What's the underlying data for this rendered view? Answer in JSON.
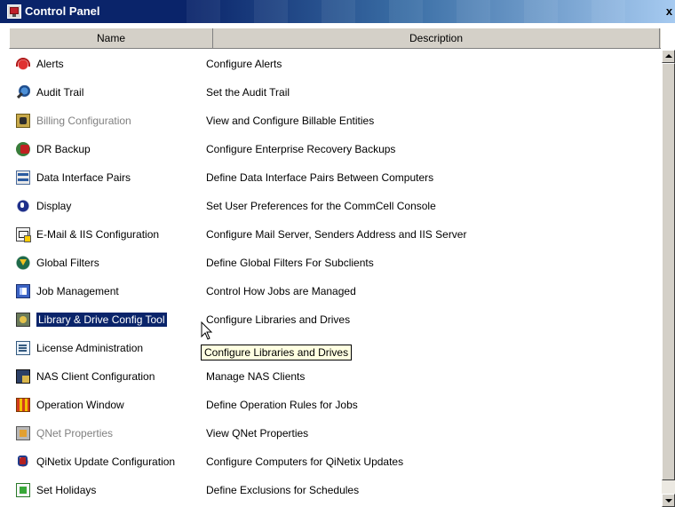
{
  "window": {
    "title": "Control Panel",
    "close_label": "x"
  },
  "table": {
    "headers": [
      "Name",
      "Description"
    ],
    "rows": [
      {
        "name": "Alerts",
        "description": "Configure Alerts",
        "icon": "alerts-icon",
        "state": "normal"
      },
      {
        "name": "Audit Trail",
        "description": "Set the Audit Trail",
        "icon": "audit-trail-icon",
        "state": "normal"
      },
      {
        "name": "Billing Configuration",
        "description": "View and Configure Billable Entities",
        "icon": "billing-icon",
        "state": "disabled"
      },
      {
        "name": "DR Backup",
        "description": "Configure Enterprise Recovery Backups",
        "icon": "dr-backup-icon",
        "state": "normal"
      },
      {
        "name": "Data Interface Pairs",
        "description": "Define Data Interface Pairs Between Computers",
        "icon": "data-interface-icon",
        "state": "normal"
      },
      {
        "name": "Display",
        "description": "Set User Preferences for the CommCell Console",
        "icon": "display-icon",
        "state": "normal"
      },
      {
        "name": "E-Mail & IIS Configuration",
        "description": "Configure Mail Server, Senders Address and IIS Server",
        "icon": "email-icon",
        "state": "normal"
      },
      {
        "name": "Global Filters",
        "description": "Define Global Filters For Subclients",
        "icon": "global-filters-icon",
        "state": "normal"
      },
      {
        "name": "Job Management",
        "description": "Control How Jobs are Managed",
        "icon": "job-management-icon",
        "state": "normal"
      },
      {
        "name": "Library & Drive Config Tool",
        "description": "Configure Libraries and Drives",
        "icon": "library-drive-icon",
        "state": "selected"
      },
      {
        "name": "License Administration",
        "description": "",
        "icon": "license-icon",
        "state": "normal"
      },
      {
        "name": "NAS Client Configuration",
        "description": "Manage NAS Clients",
        "icon": "nas-client-icon",
        "state": "normal"
      },
      {
        "name": "Operation Window",
        "description": "Define Operation Rules for Jobs",
        "icon": "operation-window-icon",
        "state": "normal"
      },
      {
        "name": "QNet Properties",
        "description": "View QNet Properties",
        "icon": "qnet-icon",
        "state": "disabled"
      },
      {
        "name": "QiNetix Update Configuration",
        "description": "Configure Computers for QiNetix Updates",
        "icon": "qinetix-update-icon",
        "state": "normal"
      },
      {
        "name": "Set Holidays",
        "description": "Define Exclusions for Schedules",
        "icon": "holidays-icon",
        "state": "normal"
      }
    ]
  },
  "tooltip": {
    "text": "Configure Libraries and Drives"
  },
  "colors": {
    "titlebar_start": "#0a246a",
    "titlebar_end": "#a6caf0",
    "selection": "#0a246a",
    "disabled_text": "#808080",
    "tooltip_bg": "#ffffe1"
  }
}
